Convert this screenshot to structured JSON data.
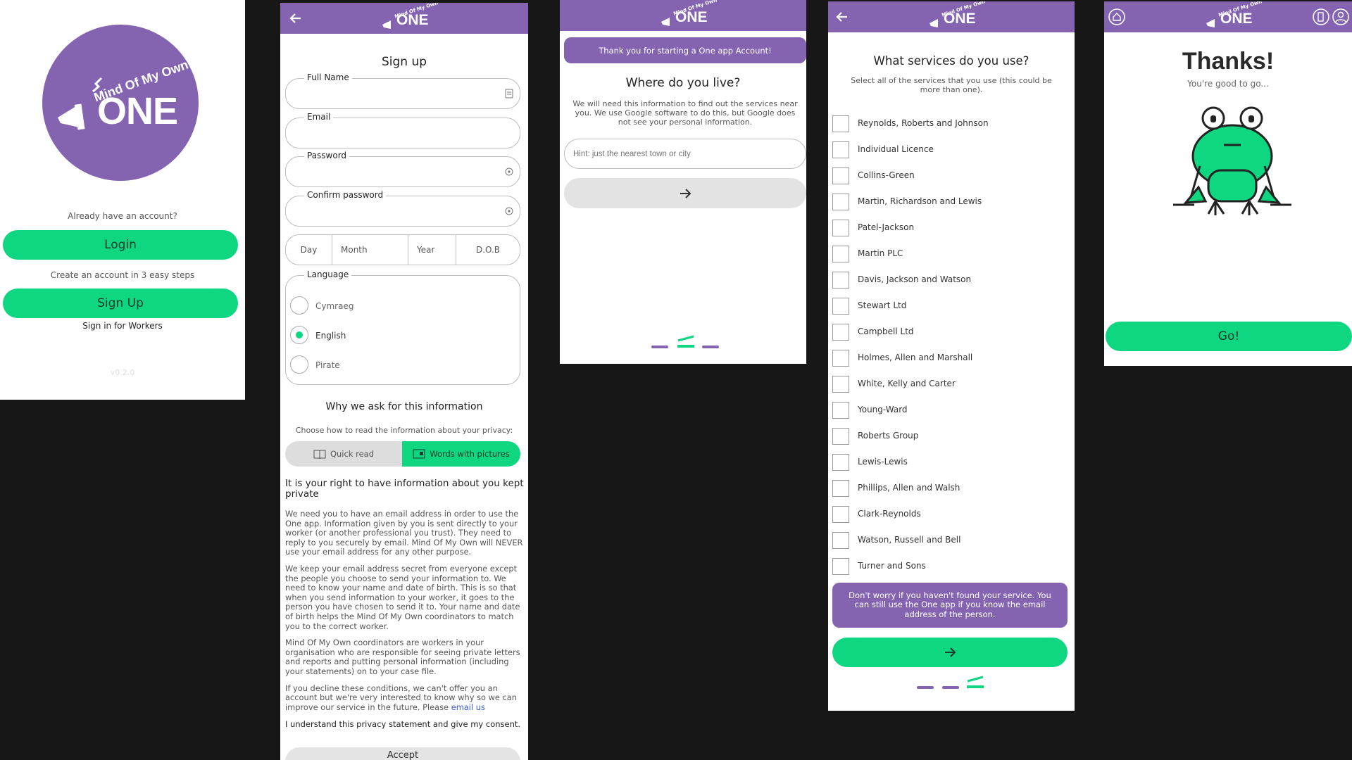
{
  "colors": {
    "purple": "#8464b1",
    "green": "#0fd680",
    "background": "#171717"
  },
  "logo": {
    "line1": "Mind Of My Own",
    "line2": "ONE"
  },
  "screen1": {
    "already_text": "Already have an account?",
    "login_label": "Login",
    "create_text": "Create an account in 3 easy steps",
    "signup_label": "Sign Up",
    "workers_link": "Sign in for Workers",
    "version": "v0.2.0"
  },
  "screen2": {
    "back_icon": "arrow-left-icon",
    "title": "Sign up",
    "fields": {
      "full_name": "Full Name",
      "email": "Email",
      "password": "Password",
      "confirm_password": "Confirm password"
    },
    "dob": {
      "day": "Day",
      "month": "Month",
      "year": "Year",
      "label": "D.O.B"
    },
    "language": {
      "legend": "Language",
      "options": [
        "Cymraeg",
        "English",
        "Pirate"
      ],
      "selected": "English"
    },
    "why_title": "Why we ask for this information",
    "choose_text": "Choose how to read the information about your privacy:",
    "toggle": {
      "quick": "Quick read",
      "pictures": "Words with pictures",
      "active": "Words with pictures"
    },
    "privacy_heading": "It is your right to have information about you kept private",
    "para1": "We need you to have an email address in order to use the One app. Information given by you is sent directly to your worker (or another professional you trust). They need to reply to you securely by email. Mind Of My Own will NEVER use your email address for any other purpose.",
    "para2": "We keep your email address secret from everyone except the people you choose to send your information to. We need to know your name and date of birth. This is so that when you send information to your worker, it goes to the person you have chosen to send it to. Your name and date of birth helps the Mind Of My Own coordinators to match you to the correct worker.",
    "para3": "Mind Of My Own coordinators are workers in your organisation who are responsible for seeing private letters and reports and putting personal information (including your statements) on to your case file.",
    "para4_prefix": "If you decline these conditions, we can't offer you an account but we're very interested to know why so we can improve our service in the future. Please ",
    "para4_link": "email us",
    "consent": "I understand this privacy statement and give my consent.",
    "accept_label": "Accept"
  },
  "screen3": {
    "banner": "Thank you for starting a One app Account!",
    "title": "Where do you live?",
    "description": "We will need this information to find out the services near you. We use Google software to do this, but Google does not see your personal information.",
    "placeholder": "Hint: just the nearest town or city",
    "next_icon": "arrow-right-icon",
    "progress": {
      "step": 2,
      "total": 3
    }
  },
  "screen4": {
    "title": "What services do you use?",
    "subtitle": "Select all of the services that you use (this could be more than one).",
    "services": [
      "Reynolds, Roberts and Johnson",
      "Individual Licence",
      "Collins-Green",
      "Martin, Richardson and Lewis",
      "Patel-Jackson",
      "Martin PLC",
      "Davis, Jackson and Watson",
      "Stewart Ltd",
      "Campbell Ltd",
      "Holmes, Allen and Marshall",
      "White, Kelly and Carter",
      "Young-Ward",
      "Roberts Group",
      "Lewis-Lewis",
      "Phillips, Allen and Walsh",
      "Clark-Reynolds",
      "Watson, Russell and Bell",
      "Turner and Sons"
    ],
    "notice": "Don't worry if you haven't found your service. You can still use the One app if you know the email address of the person.",
    "next_icon": "arrow-right-icon",
    "progress": {
      "step": 3,
      "total": 3
    }
  },
  "screen5": {
    "home_icon": "home-icon",
    "exit_icon": "exit-door-icon",
    "profile_icon": "profile-icon",
    "title": "Thanks!",
    "subtitle": "You're good to go...",
    "image_icon": "frog-icon",
    "go_label": "Go!"
  }
}
